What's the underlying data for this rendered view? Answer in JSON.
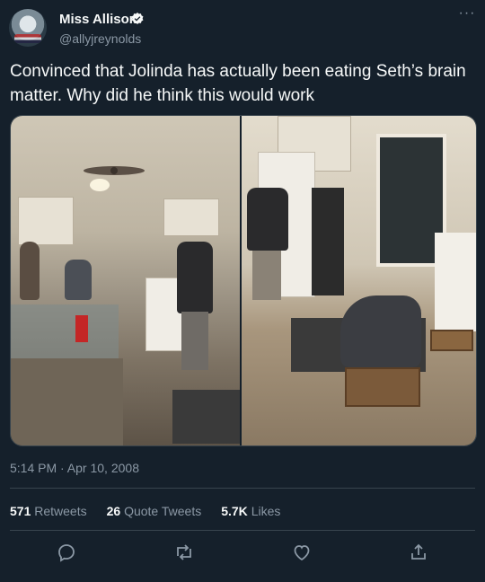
{
  "user": {
    "display_name": "Miss Allison",
    "handle": "@allyjreynolds"
  },
  "tweet": {
    "text": "Convinced that Jolinda has actually been eating Seth’s brain matter. Why did he think this would work",
    "timestamp": "5:14 PM · Apr 10, 2008"
  },
  "stats": {
    "retweets_count": "571",
    "retweets_label": "Retweets",
    "quotes_count": "26",
    "quotes_label": "Quote Tweets",
    "likes_count": "5.7K",
    "likes_label": "Likes"
  },
  "icons": {
    "verified": "verified-badge-icon",
    "more": "more-options-icon",
    "reply": "reply-icon",
    "retweet": "retweet-icon",
    "like": "heart-icon",
    "share": "share-icon"
  },
  "colors": {
    "background": "#15202b",
    "text": "#f7f9f9",
    "muted": "#8b98a5",
    "border": "#38444d"
  }
}
